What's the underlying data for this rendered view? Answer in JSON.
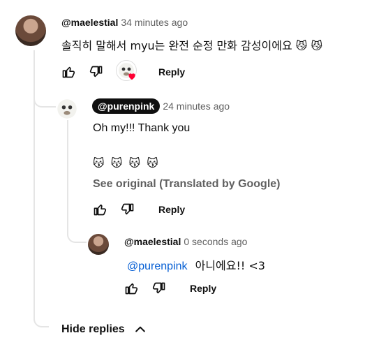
{
  "comment": {
    "author": "@maelestial",
    "time": "34 minutes ago",
    "text": "솔직히 말해서 myu는 완전 순정 만화 감성이에요 😼 😼",
    "reply_label": "Reply"
  },
  "reply1": {
    "author": "@purenpink",
    "time": "24 minutes ago",
    "text": "Oh my!!! Thank you",
    "emojis": "😽 😽 😽 😽",
    "see_original": "See original (Translated by Google)",
    "reply_label": "Reply"
  },
  "reply2": {
    "author": "@maelestial",
    "time": "0 seconds ago",
    "mention": "@purenpink",
    "text": "아니에요!! <3",
    "reply_label": "Reply"
  },
  "hide_replies_label": "Hide replies"
}
